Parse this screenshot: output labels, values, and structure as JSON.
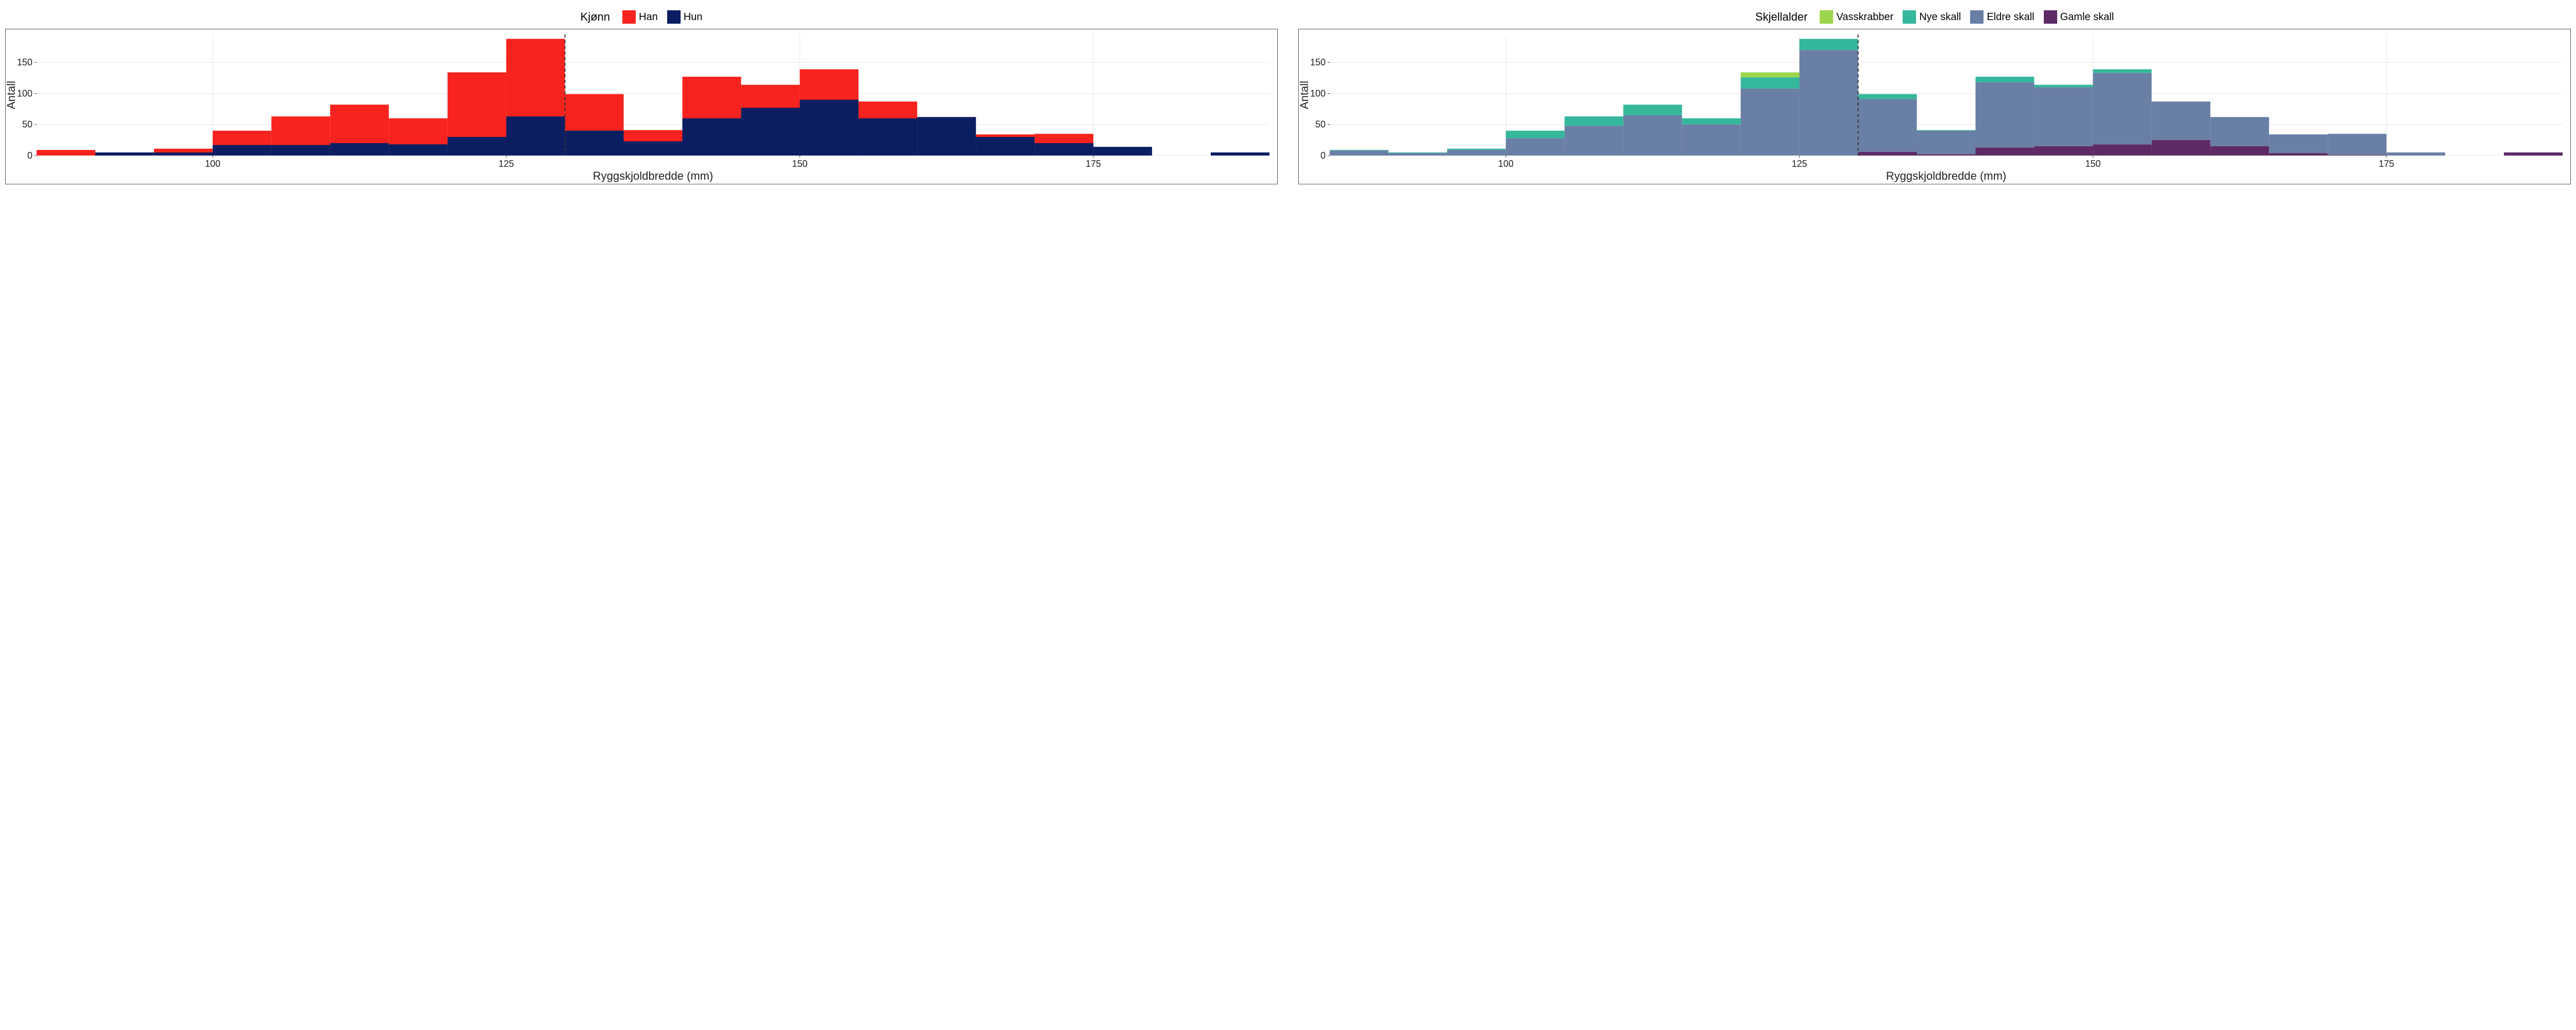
{
  "left": {
    "legend_title": "Kjønn",
    "series_labels": {
      "han": "Han",
      "hun": "Hun"
    },
    "colors": {
      "han": "#f8231e",
      "hun": "#0b1e62"
    }
  },
  "right": {
    "legend_title": "Skjellalder",
    "series_labels": {
      "vasskrabber": "Vasskrabber",
      "nye": "Nye skall",
      "eldre": "Eldre skall",
      "gamle": "Gamle skall"
    },
    "colors": {
      "vasskrabber": "#9bd54b",
      "nye": "#35b79b",
      "eldre": "#6a7fa6",
      "gamle": "#5d2a66"
    }
  },
  "axis": {
    "xlabel": "Ryggskjoldbredde (mm)",
    "ylabel": "Antall",
    "xticks": [
      100,
      125,
      150,
      175
    ],
    "yticks": [
      0,
      50,
      100,
      150
    ],
    "ylim": [
      0,
      195
    ],
    "refline_x": 130
  },
  "chart_data": [
    {
      "type": "bar",
      "title": "Kjønn",
      "xlabel": "Ryggskjoldbredde (mm)",
      "ylabel": "Antall",
      "ylim": [
        0,
        195
      ],
      "bin_edges": [
        85,
        90,
        95,
        100,
        105,
        110,
        115,
        120,
        125,
        130,
        135,
        140,
        145,
        150,
        155,
        160,
        165,
        170,
        175,
        180,
        185,
        190
      ],
      "refline_x": 130,
      "series": [
        {
          "name": "Han",
          "color": "#f8231e",
          "values": [
            9,
            0,
            11,
            40,
            63,
            82,
            60,
            134,
            188,
            99,
            41,
            127,
            114,
            139,
            87,
            62,
            34,
            35,
            5,
            0,
            0
          ]
        },
        {
          "name": "Hun",
          "color": "#0b1e62",
          "values": [
            0,
            5,
            5,
            17,
            17,
            20,
            18,
            30,
            63,
            40,
            23,
            60,
            77,
            90,
            60,
            62,
            30,
            20,
            14,
            0,
            5
          ]
        }
      ]
    },
    {
      "type": "bar",
      "title": "Skjellalder",
      "xlabel": "Ryggskjoldbredde (mm)",
      "ylabel": "Antall",
      "ylim": [
        0,
        195
      ],
      "bin_edges": [
        85,
        90,
        95,
        100,
        105,
        110,
        115,
        120,
        125,
        130,
        135,
        140,
        145,
        150,
        155,
        160,
        165,
        170,
        175,
        180,
        185,
        190
      ],
      "refline_x": 130,
      "stacked": true,
      "series": [
        {
          "name": "Gamle skall",
          "color": "#5d2a66",
          "values": [
            0,
            0,
            0,
            0,
            0,
            0,
            0,
            0,
            0,
            6,
            2,
            13,
            15,
            18,
            25,
            15,
            4,
            1,
            0,
            0,
            5
          ]
        },
        {
          "name": "Eldre skall",
          "color": "#6a7fa6",
          "values": [
            8,
            4,
            9,
            28,
            48,
            65,
            50,
            108,
            170,
            85,
            38,
            105,
            95,
            115,
            62,
            47,
            30,
            34,
            5,
            0,
            0
          ]
        },
        {
          "name": "Nye skall",
          "color": "#35b79b",
          "values": [
            1,
            1,
            2,
            12,
            15,
            17,
            10,
            18,
            18,
            8,
            1,
            9,
            4,
            6,
            0,
            0,
            0,
            0,
            0,
            0,
            0
          ]
        },
        {
          "name": "Vasskrabber",
          "color": "#9bd54b",
          "values": [
            0,
            0,
            0,
            0,
            0,
            0,
            0,
            8,
            0,
            0,
            0,
            0,
            0,
            0,
            0,
            0,
            0,
            0,
            0,
            0,
            0
          ]
        }
      ]
    }
  ]
}
